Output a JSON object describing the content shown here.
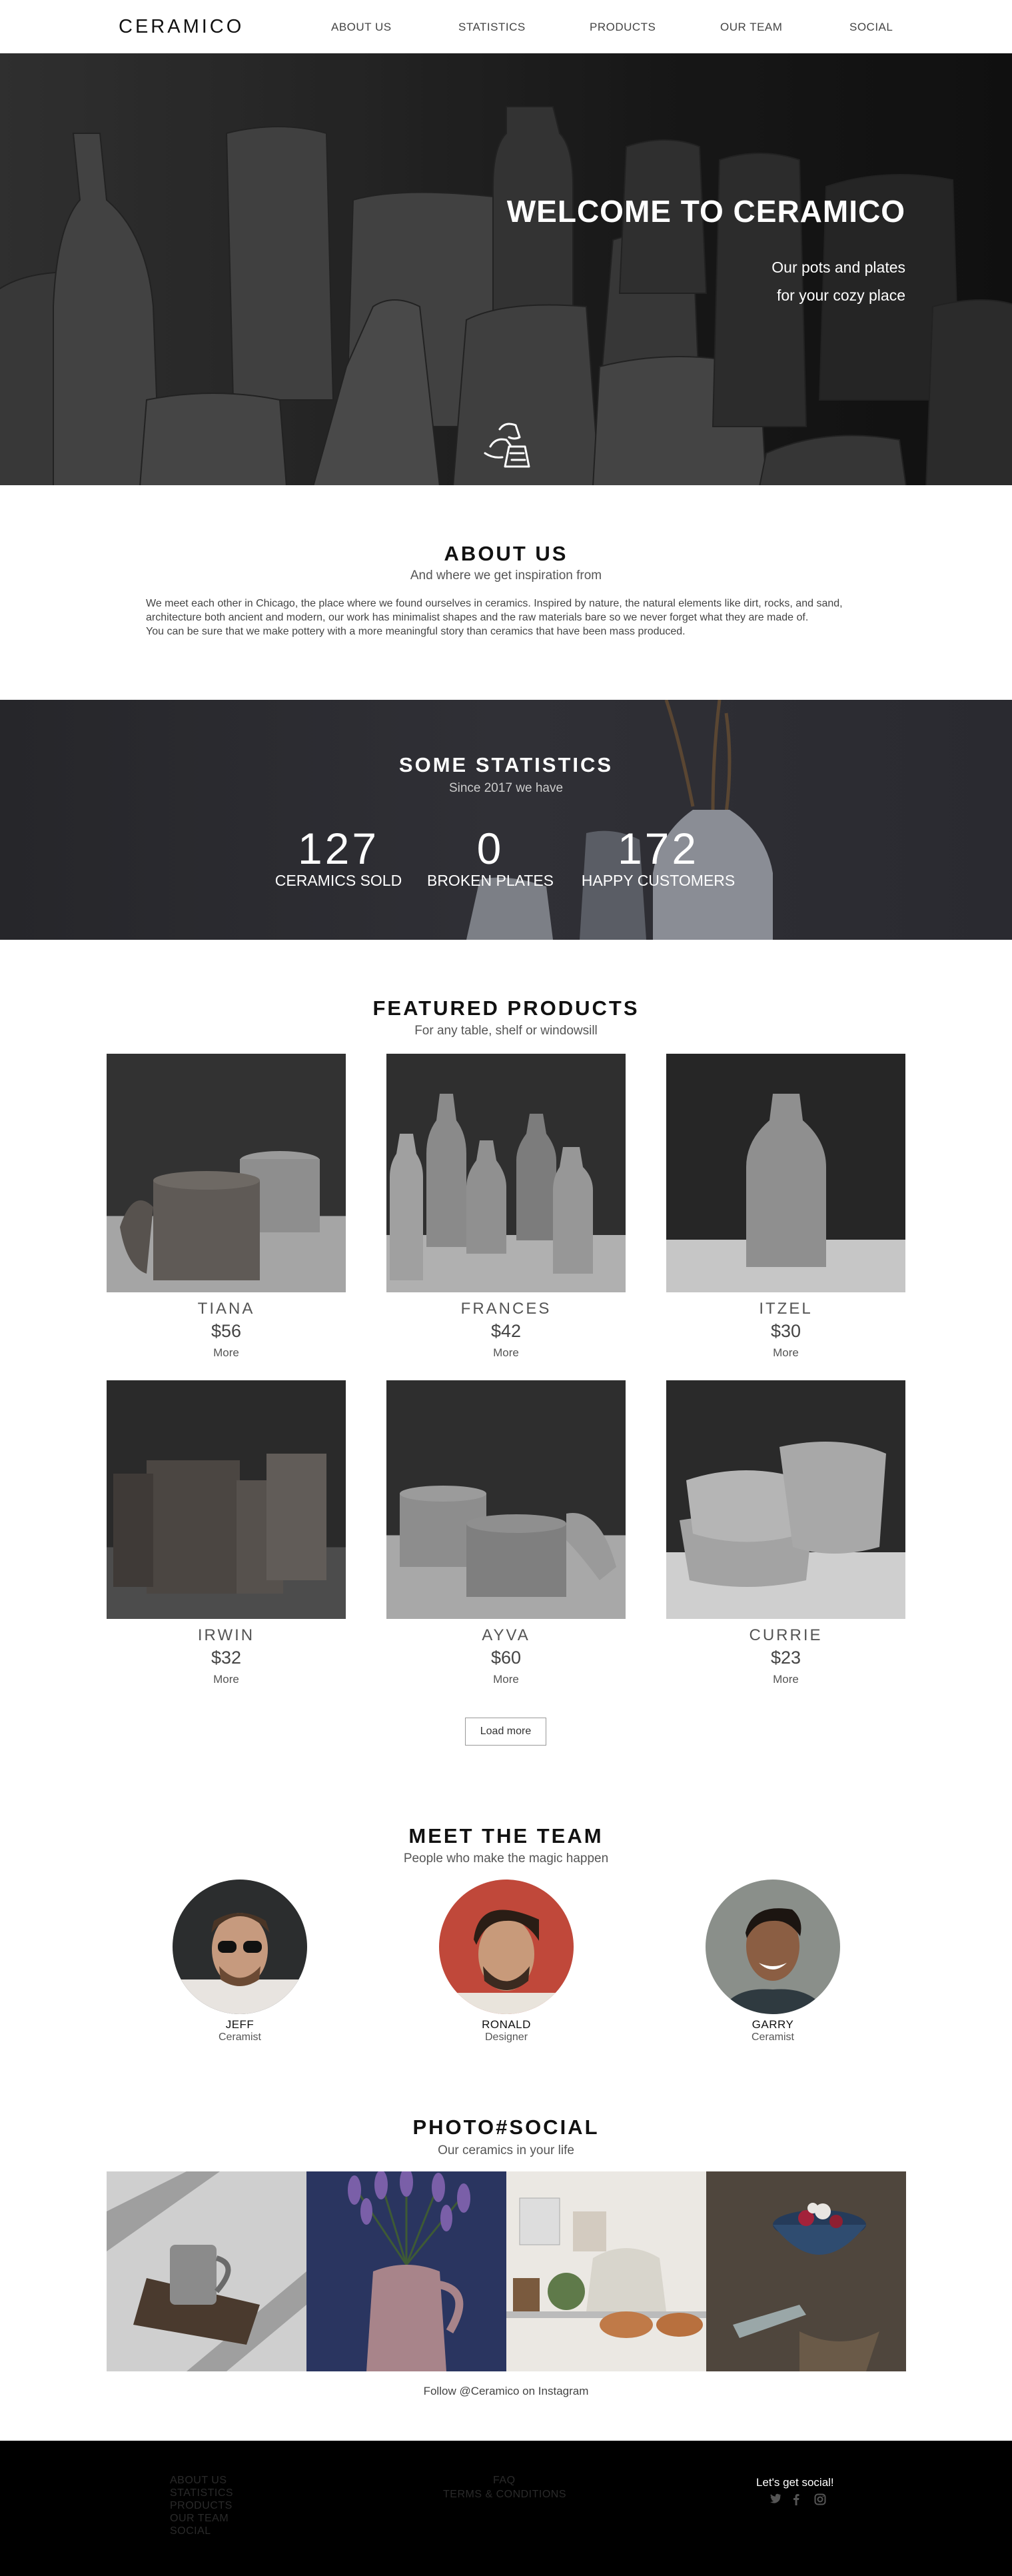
{
  "nav": {
    "logo": "CERAMICO",
    "items": [
      "ABOUT US",
      "STATISTICS",
      "PRODUCTS",
      "OUR TEAM",
      "SOCIAL"
    ]
  },
  "hero": {
    "title": "WELCOME TO CERAMICO",
    "subtitle_line1": "Our pots and plates",
    "subtitle_line2": "for your cozy place"
  },
  "about": {
    "title": "ABOUT US",
    "subtitle": "And where we get inspiration from",
    "paragraph1": "We meet each other in Chicago, the place where we found ourselves in ceramics. Inspired by nature, the natural elements like dirt, rocks, and sand, architecture both ancient and modern, our work has minimalist shapes and the raw materials bare so we never forget what they are made of.",
    "paragraph2": "You can be sure that we make pottery with a more meaningful story than ceramics that have been mass produced."
  },
  "stats": {
    "title": "SOME STATISTICS",
    "subtitle": "Since 2017 we have",
    "items": [
      {
        "value": "127",
        "label": "CERAMICS SOLD"
      },
      {
        "value": "0",
        "label": "BROKEN PLATES"
      },
      {
        "value": "172",
        "label": "HAPPY CUSTOMERS"
      }
    ]
  },
  "products": {
    "title": "FEATURED PRODUCTS",
    "subtitle": "For any table, shelf or windowsill",
    "items": [
      {
        "name": "TIANA",
        "price": "$56",
        "more": "More"
      },
      {
        "name": "FRANCES",
        "price": "$42",
        "more": "More"
      },
      {
        "name": "ITZEL",
        "price": "$30",
        "more": "More"
      },
      {
        "name": "IRWIN",
        "price": "$32",
        "more": "More"
      },
      {
        "name": "AYVA",
        "price": "$60",
        "more": "More"
      },
      {
        "name": "CURRIE",
        "price": "$23",
        "more": "More"
      }
    ],
    "load_more": "Load more"
  },
  "team": {
    "title": "MEET THE TEAM",
    "subtitle": "People who make the magic happen",
    "members": [
      {
        "name": "JEFF",
        "role": "Ceramist"
      },
      {
        "name": "RONALD",
        "role": "Designer"
      },
      {
        "name": "GARRY",
        "role": "Ceramist"
      }
    ]
  },
  "social": {
    "title": "PHOTO#SOCIAL",
    "subtitle": "Our ceramics in your life",
    "follow": "Follow @Ceramico on Instagram"
  },
  "footer": {
    "nav_links": [
      "ABOUT US",
      "STATISTICS",
      "PRODUCTS",
      "OUR TEAM",
      "SOCIAL"
    ],
    "info_links": [
      "FAQ",
      "TERMS & CONDITIONS"
    ],
    "social_heading": "Let's get social!",
    "icons": [
      "twitter-icon",
      "facebook-icon",
      "instagram-icon"
    ]
  }
}
